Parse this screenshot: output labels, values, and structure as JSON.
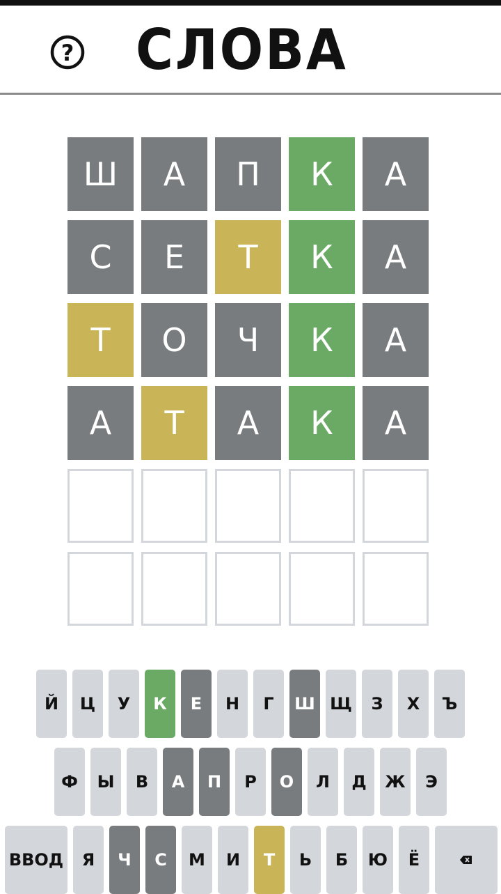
{
  "header": {
    "title": "СЛОВА",
    "help_symbol": "?"
  },
  "board": {
    "rows": [
      [
        {
          "letter": "Ш",
          "state": "absent"
        },
        {
          "letter": "А",
          "state": "absent"
        },
        {
          "letter": "П",
          "state": "absent"
        },
        {
          "letter": "К",
          "state": "correct"
        },
        {
          "letter": "А",
          "state": "absent"
        }
      ],
      [
        {
          "letter": "С",
          "state": "absent"
        },
        {
          "letter": "Е",
          "state": "absent"
        },
        {
          "letter": "Т",
          "state": "present"
        },
        {
          "letter": "К",
          "state": "correct"
        },
        {
          "letter": "А",
          "state": "absent"
        }
      ],
      [
        {
          "letter": "Т",
          "state": "present"
        },
        {
          "letter": "О",
          "state": "absent"
        },
        {
          "letter": "Ч",
          "state": "absent"
        },
        {
          "letter": "К",
          "state": "correct"
        },
        {
          "letter": "А",
          "state": "absent"
        }
      ],
      [
        {
          "letter": "А",
          "state": "absent"
        },
        {
          "letter": "Т",
          "state": "present"
        },
        {
          "letter": "А",
          "state": "absent"
        },
        {
          "letter": "К",
          "state": "correct"
        },
        {
          "letter": "А",
          "state": "absent"
        }
      ],
      [
        {
          "letter": "",
          "state": "empty"
        },
        {
          "letter": "",
          "state": "empty"
        },
        {
          "letter": "",
          "state": "empty"
        },
        {
          "letter": "",
          "state": "empty"
        },
        {
          "letter": "",
          "state": "empty"
        }
      ],
      [
        {
          "letter": "",
          "state": "empty"
        },
        {
          "letter": "",
          "state": "empty"
        },
        {
          "letter": "",
          "state": "empty"
        },
        {
          "letter": "",
          "state": "empty"
        },
        {
          "letter": "",
          "state": "empty"
        }
      ]
    ]
  },
  "keyboard": {
    "rows": [
      [
        {
          "label": "Й",
          "state": ""
        },
        {
          "label": "Ц",
          "state": ""
        },
        {
          "label": "У",
          "state": ""
        },
        {
          "label": "К",
          "state": "correct"
        },
        {
          "label": "Е",
          "state": "absent"
        },
        {
          "label": "Н",
          "state": ""
        },
        {
          "label": "Г",
          "state": ""
        },
        {
          "label": "Ш",
          "state": "absent"
        },
        {
          "label": "Щ",
          "state": ""
        },
        {
          "label": "З",
          "state": ""
        },
        {
          "label": "Х",
          "state": ""
        },
        {
          "label": "Ъ",
          "state": ""
        }
      ],
      [
        {
          "label": "Ф",
          "state": ""
        },
        {
          "label": "Ы",
          "state": ""
        },
        {
          "label": "В",
          "state": ""
        },
        {
          "label": "А",
          "state": "absent"
        },
        {
          "label": "П",
          "state": "absent"
        },
        {
          "label": "Р",
          "state": ""
        },
        {
          "label": "О",
          "state": "absent"
        },
        {
          "label": "Л",
          "state": ""
        },
        {
          "label": "Д",
          "state": ""
        },
        {
          "label": "Ж",
          "state": ""
        },
        {
          "label": "Э",
          "state": ""
        }
      ],
      [
        {
          "label": "ВВОД",
          "state": "",
          "kind": "enter"
        },
        {
          "label": "Я",
          "state": ""
        },
        {
          "label": "Ч",
          "state": "absent"
        },
        {
          "label": "С",
          "state": "absent"
        },
        {
          "label": "М",
          "state": ""
        },
        {
          "label": "И",
          "state": ""
        },
        {
          "label": "Т",
          "state": "present"
        },
        {
          "label": "Ь",
          "state": ""
        },
        {
          "label": "Б",
          "state": ""
        },
        {
          "label": "Ю",
          "state": ""
        },
        {
          "label": "Ё",
          "state": ""
        },
        {
          "label": "",
          "state": "",
          "kind": "backspace",
          "icon": "backspace-icon"
        }
      ]
    ]
  },
  "colors": {
    "absent": "#787c7e",
    "present": "#c9b458",
    "correct": "#6aaa64",
    "key_default": "#d3d6da",
    "empty_border": "#d3d6da"
  }
}
